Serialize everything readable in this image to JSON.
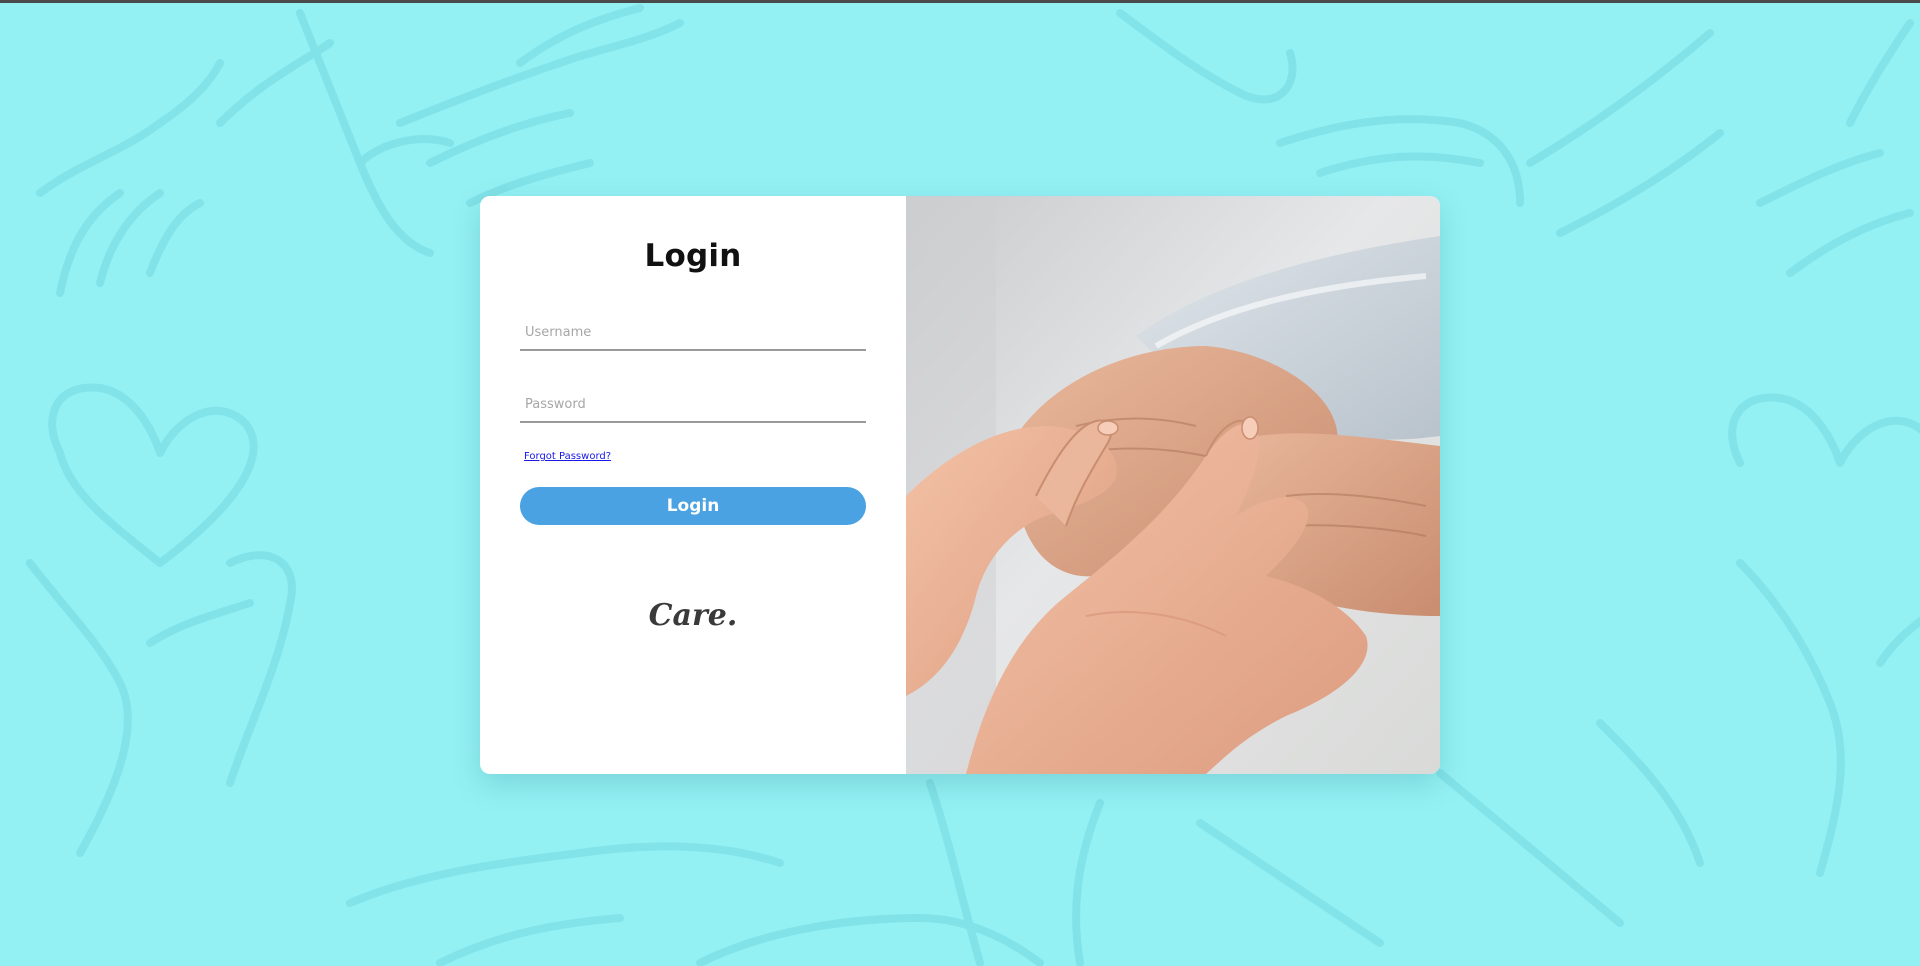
{
  "login": {
    "title": "Login",
    "username_placeholder": "Username",
    "password_placeholder": "Password",
    "forgot_label": "Forgot Password?",
    "button_label": "Login",
    "brand": "Care."
  },
  "colors": {
    "background": "#93f1f4",
    "button": "#4aa2e2",
    "link": "#1a17e8",
    "card": "#ffffff"
  },
  "images": {
    "hero": "photo of hands holding an elderly person's hands"
  }
}
